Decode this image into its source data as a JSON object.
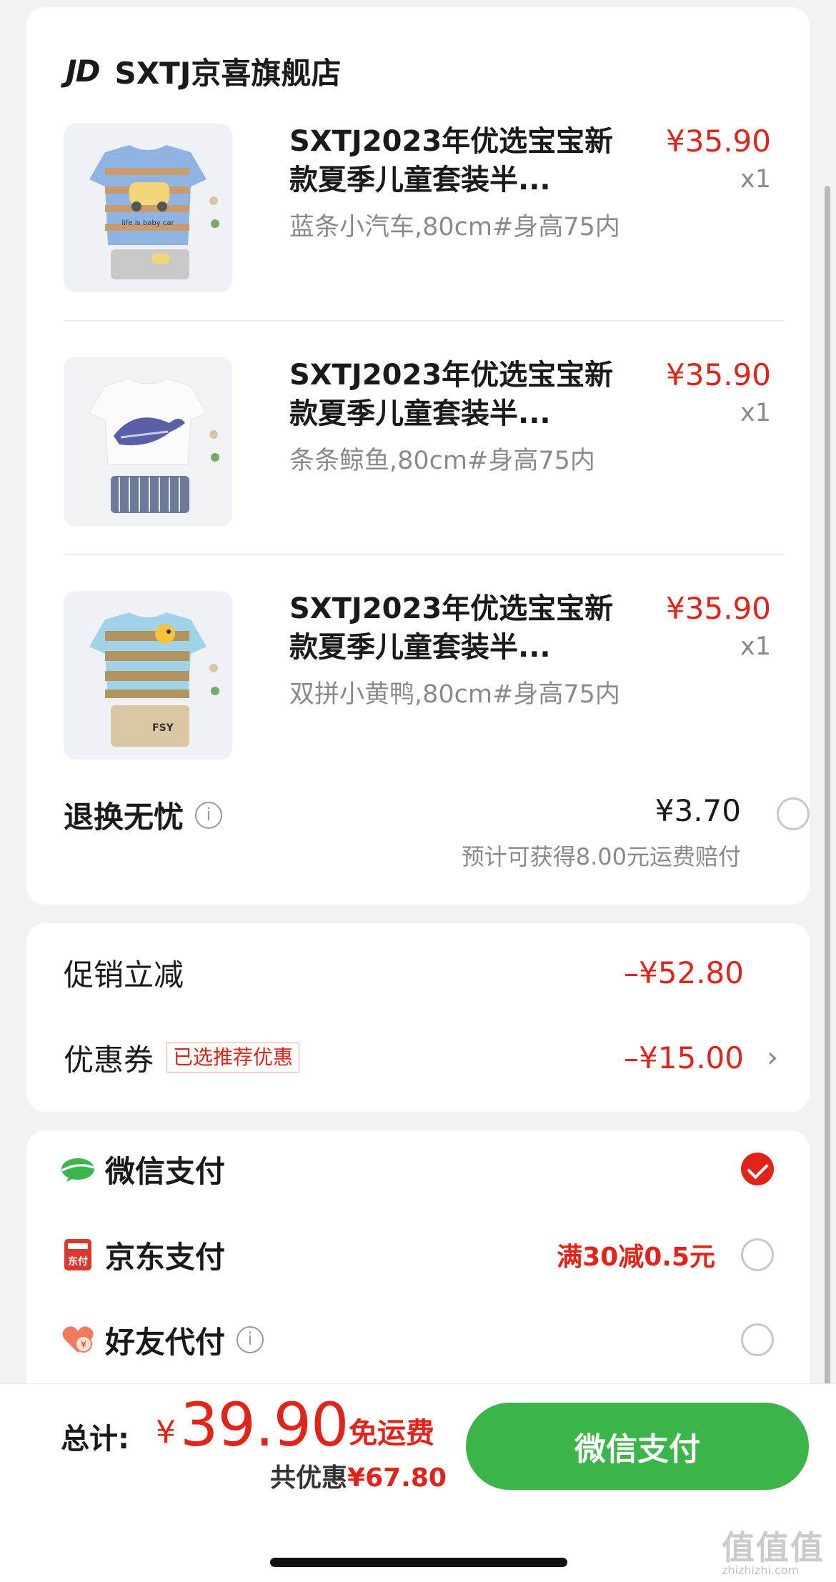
{
  "store": {
    "logo": "JD",
    "name": "SXTJ京喜旗舰店"
  },
  "items": [
    {
      "title": "SXTJ2023年优选宝宝新款夏季儿童套装半...",
      "spec": "蓝条小汽车,80cm#身高75内",
      "price": "¥35.90",
      "qty": "x1"
    },
    {
      "title": "SXTJ2023年优选宝宝新款夏季儿童套装半...",
      "spec": "条条鲸鱼,80cm#身高75内",
      "price": "¥35.90",
      "qty": "x1"
    },
    {
      "title": "SXTJ2023年优选宝宝新款夏季儿童套装半...",
      "spec": "双拼小黄鸭,80cm#身高75内",
      "price": "¥35.90",
      "qty": "x1"
    }
  ],
  "insurance": {
    "label": "退换无忧",
    "info": "i",
    "price": "¥3.70",
    "note": "预计可获得8.00元运费赔付"
  },
  "discounts": {
    "promo_label": "促销立减",
    "promo_value": "–¥52.80",
    "coupon_label": "优惠券",
    "coupon_tag": "已选推荐优惠",
    "coupon_value": "–¥15.00",
    "chevron": "›"
  },
  "payment": {
    "wechat_label": "微信支付",
    "jd_label": "京东支付",
    "jd_icon_text": "东付",
    "jd_promo": "满30减0.5元",
    "friend_label": "好友代付",
    "info": "i"
  },
  "footer": {
    "total_label": "总计:",
    "currency": "¥",
    "total": "39.90",
    "free_shipping": "免运费",
    "saved_prefix": "共优惠",
    "saved_amount": "¥67.80",
    "pay_button": "微信支付"
  },
  "watermark": {
    "main": "值值值",
    "sub": "zhizhizhi.com"
  },
  "colors": {
    "accent_red": "#e2231a",
    "pay_green": "#3bb449"
  }
}
